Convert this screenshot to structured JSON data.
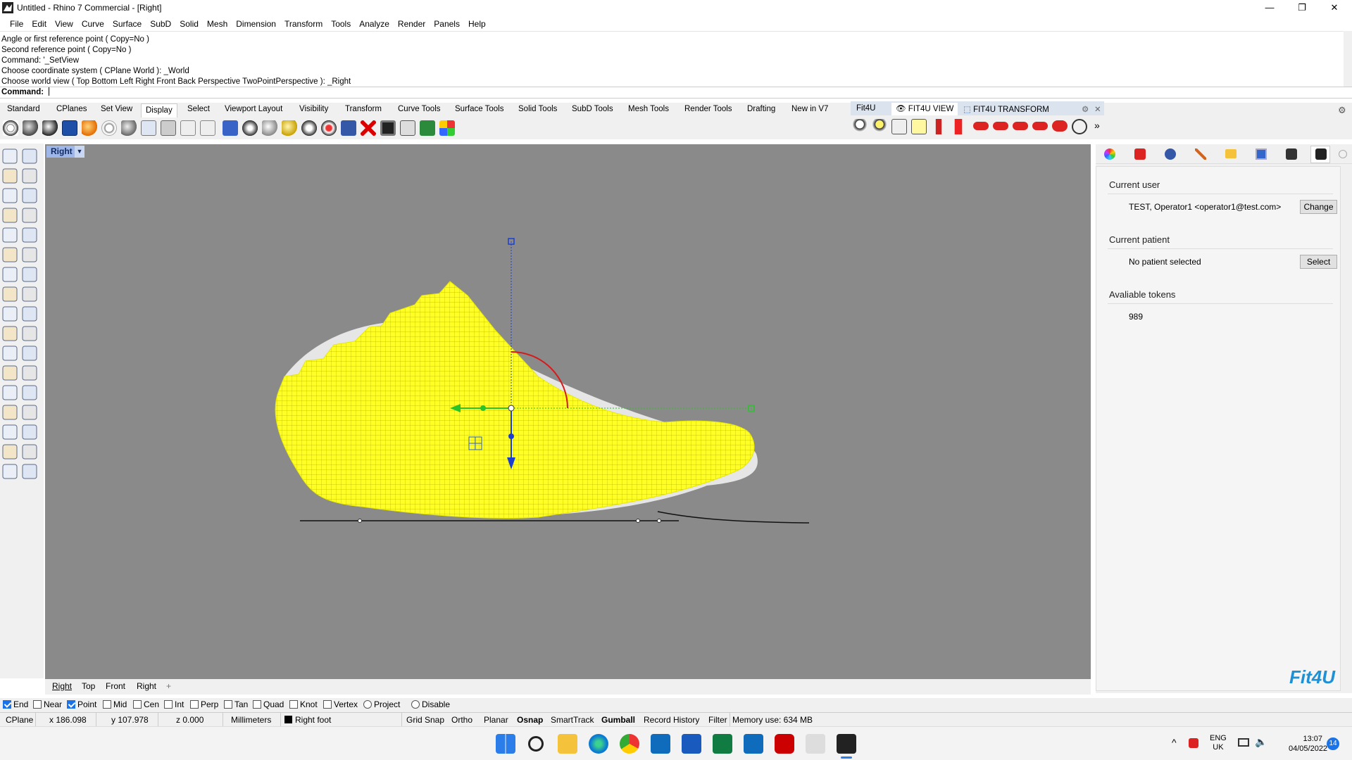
{
  "window": {
    "title": "Untitled - Rhino 7 Commercial - [Right]",
    "minimize": "—",
    "maximize": "❐",
    "close": "✕"
  },
  "menu": [
    "File",
    "Edit",
    "View",
    "Curve",
    "Surface",
    "SubD",
    "Solid",
    "Mesh",
    "Dimension",
    "Transform",
    "Tools",
    "Analyze",
    "Render",
    "Panels",
    "Help"
  ],
  "command_history": [
    "Angle or first reference point ( Copy=No )",
    "Second reference point ( Copy=No )",
    "Command: '_SetView",
    "Choose coordinate system ( CPlane  World ): _World",
    "Choose world view ( Top  Bottom  Left  Right  Front  Back  Perspective  TwoPointPerspective ): _Right"
  ],
  "command_prompt": "Command:",
  "toolbar_tabs": [
    "Standard",
    "CPlanes",
    "Set View",
    "Display",
    "Select",
    "Viewport Layout",
    "Visibility",
    "Transform",
    "Curve Tools",
    "Surface Tools",
    "Solid Tools",
    "SubD Tools",
    "Mesh Tools",
    "Render Tools",
    "Drafting",
    "New in V7"
  ],
  "active_tab": "Display",
  "fit_tabs": [
    "Fit4U",
    "FIT4U VIEW",
    "FIT4U TRANSFORM"
  ],
  "viewport": {
    "name": "Right",
    "tabs": [
      "Right",
      "Top",
      "Front",
      "Right"
    ],
    "add_tab": "+"
  },
  "panel": {
    "current_user_title": "Current user",
    "current_user": "TEST, Operator1 <operator1@test.com>",
    "change_label": "Change",
    "current_patient_title": "Current patient",
    "current_patient": "No patient selected",
    "select_label": "Select",
    "tokens_title": "Avaliable tokens",
    "tokens": "989",
    "logo": "Fit4U"
  },
  "osnap": [
    {
      "label": "End",
      "checked": true
    },
    {
      "label": "Near",
      "checked": false
    },
    {
      "label": "Point",
      "checked": true
    },
    {
      "label": "Mid",
      "checked": false
    },
    {
      "label": "Cen",
      "checked": false
    },
    {
      "label": "Int",
      "checked": false
    },
    {
      "label": "Perp",
      "checked": false
    },
    {
      "label": "Tan",
      "checked": false
    },
    {
      "label": "Quad",
      "checked": false
    },
    {
      "label": "Knot",
      "checked": false
    },
    {
      "label": "Vertex",
      "checked": false
    },
    {
      "label": "Project",
      "checked": false
    },
    {
      "label": "Disable",
      "checked": false
    }
  ],
  "status": {
    "cplane": "CPlane",
    "x": "x 186.098",
    "y": "y 107.978",
    "z": "z 0.000",
    "units": "Millimeters",
    "layer": "Right foot",
    "grid_snap": "Grid Snap",
    "ortho": "Ortho",
    "planar": "Planar",
    "osnap": "Osnap",
    "smarttrack": "SmartTrack",
    "gumball": "Gumball",
    "record_history": "Record History",
    "filter": "Filter",
    "memory": "Memory use: 634 MB"
  },
  "taskbar": {
    "lang1": "ENG",
    "lang2": "UK",
    "time": "13:07",
    "date": "04/05/2022",
    "badge": "14"
  }
}
